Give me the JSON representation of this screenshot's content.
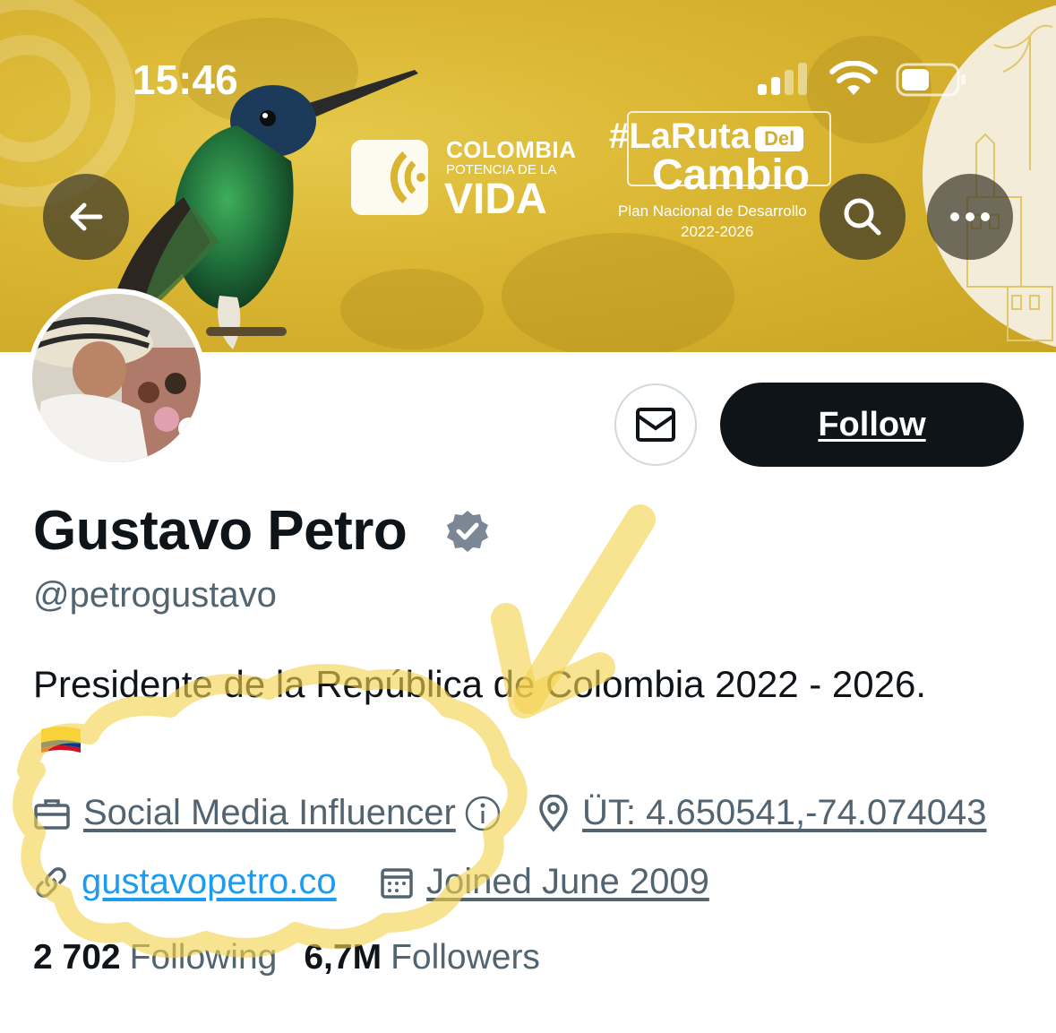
{
  "status_bar": {
    "time": "15:46"
  },
  "banner": {
    "logo1_title": "COLOMBIA",
    "logo1_sub": "POTENCIA DE LA",
    "logo1_big": "VIDA",
    "logo2_hash": "#LaRuta",
    "logo2_del": "Del",
    "logo2_big": "Cambio",
    "logo2_plan": "Plan Nacional de Desarrollo",
    "logo2_years": "2022-2026"
  },
  "buttons": {
    "follow": "Follow"
  },
  "profile": {
    "name": "Gustavo Petro",
    "handle": "@petrogustavo",
    "bio": "Presidente de la República de Colombia 2022 - 2026.",
    "category": "Social Media Influencer",
    "location": "ÜT: 4.650541,-74.074043",
    "website": "gustavopetro.co",
    "joined": "Joined June 2009"
  },
  "stats": {
    "following_count": "2 702",
    "following_label": "Following",
    "followers_count": "6,7M",
    "followers_label": "Followers"
  },
  "colors": {
    "banner": "#d9b531",
    "follow_bg": "#0f1419",
    "secondary_text": "#536471",
    "link": "#1d9bf0",
    "highlight_overlay": "#f3d24d"
  },
  "icons": [
    "back-arrow-icon",
    "search-icon",
    "more-icon",
    "mail-icon",
    "verified-badge-icon",
    "briefcase-icon",
    "info-icon",
    "location-pin-icon",
    "link-icon",
    "calendar-icon",
    "flag-icon"
  ]
}
